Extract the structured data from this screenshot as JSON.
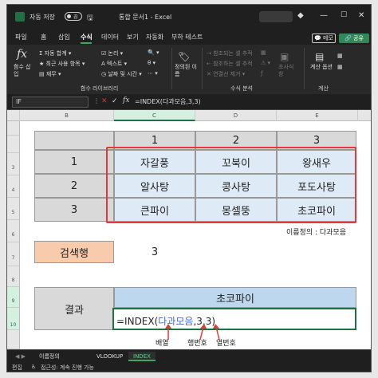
{
  "titlebar": {
    "autosave_label": "자동 저장",
    "autosave_state": "끔",
    "document_title": "통합 문서1 - Excel"
  },
  "menu": {
    "items": [
      "파일",
      "홈",
      "삽입",
      "수식",
      "데이터",
      "보기",
      "자동화",
      "부하 테스트"
    ],
    "active": "수식",
    "memo_label": "메모",
    "share_label": "공유"
  },
  "ribbon": {
    "insert_function_label": "함수 삽입",
    "autosum_label": "자동 합계",
    "recent_label": "최근 사용 항목",
    "finance_label": "재무",
    "logical_label": "논리",
    "text_label": "텍스트",
    "datetime_label": "날짜 및 시간",
    "names_label": "정의된 이름",
    "trace_precedents_label": "참조되는 셀 추적",
    "trace_dependents_label": "참조하는 셀 추적",
    "remove_arrows_label": "연결선 제거",
    "watch_label": "조사식 창",
    "calc_options_label": "계산 옵션",
    "group_library": "함수 라이브러리",
    "group_audit": "수식 분석",
    "group_calc": "계산"
  },
  "formula_bar": {
    "name_box": "IF",
    "formula": "=INDEX(다과모음,3,3)"
  },
  "columns": [
    "B",
    "C",
    "D",
    "E"
  ],
  "rows": [
    "3",
    "4",
    "5",
    "6",
    "7",
    "8",
    "9",
    "10"
  ],
  "table": {
    "col_headers": [
      "1",
      "2",
      "3"
    ],
    "row_headers": [
      "1",
      "2",
      "3"
    ],
    "cells": [
      [
        "자갈풍",
        "꼬북이",
        "왕새우"
      ],
      [
        "알사탕",
        "콩사탕",
        "포도사탕"
      ],
      [
        "큰파이",
        "몽셀뚱",
        "초코파이"
      ]
    ],
    "name_note": "이름정의 : 다과모음"
  },
  "search": {
    "label": "검색행",
    "value": "3"
  },
  "result": {
    "label": "결과",
    "value": "초코파이",
    "edit_prefix": "=INDEX(",
    "edit_name": "다과모음",
    "edit_suffix": ",3,3)"
  },
  "annotations": {
    "array": "배열",
    "row_num": "행번호",
    "col_num": "열번호"
  },
  "sheet_tabs": [
    "이름정의",
    "VLOOKUP",
    "INDEX"
  ],
  "active_tab": "INDEX",
  "status": {
    "mode": "편집",
    "accessibility": "접근성: 계속 진행 가능"
  },
  "colors": {
    "accent": "#1e7145",
    "annotation": "#e53935",
    "data_fill": "#deebf7",
    "label_fill": "#f8cbad"
  }
}
